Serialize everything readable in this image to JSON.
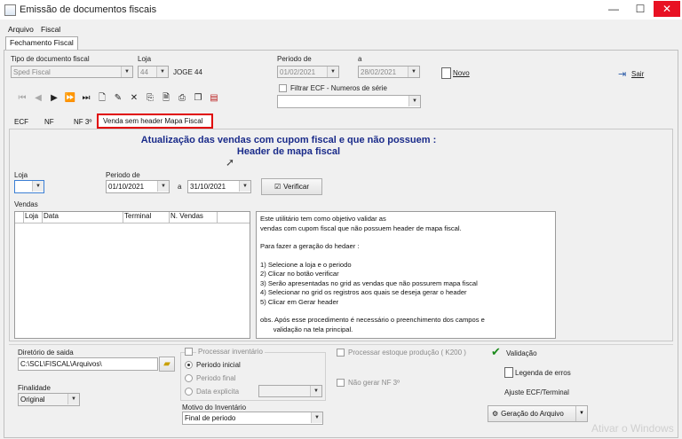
{
  "window": {
    "title": "Emissão de documentos fiscais",
    "min": "—",
    "max": "☐",
    "close": "✕"
  },
  "menu": [
    "Arquivo",
    "Fiscal"
  ],
  "main_tab": "Fechamento Fiscal",
  "top": {
    "tipo_label": "Tipo de documento fiscal",
    "tipo_value": "Sped Fiscal",
    "loja_label": "Loja",
    "loja_value": "44",
    "loja_name": "JOGE 44",
    "periodo_label": "Periodo de",
    "a_label": "a",
    "periodo_de": "01/02/2021",
    "periodo_a": "28/02/2021",
    "filtrar_label": "Filtrar ECF - Numeros de  série",
    "novo_label": "Novo",
    "sair_label": "Sair"
  },
  "toolbar_icons": [
    "first-record-icon",
    "prev-record-icon",
    "next-record-icon",
    "fast-forward-icon",
    "last-record-icon",
    "new-document-icon",
    "edit-document-icon",
    "delete-icon",
    "export-icon",
    "preview-icon",
    "print-icon",
    "copy-icon",
    "report-icon"
  ],
  "subtabs": [
    "ECF",
    "NF",
    "NF 3º",
    "Venda sem header Mapa Fiscal"
  ],
  "content": {
    "heading_line1": "Atualização das vendas com cupom fiscal e que não possuem :",
    "heading_line2": "Header de mapa fiscal",
    "loja_label": "Loja",
    "loja_value": "",
    "periodo_label": "Periodo de",
    "periodo_de": "01/10/2021",
    "a_label": "a",
    "periodo_a": "31/10/2021",
    "verificar_label": "Verificar",
    "vendas_label": "Vendas",
    "grid_columns": [
      "",
      "Loja",
      "Data",
      "Terminal",
      "N. Vendas"
    ],
    "info_lines": [
      "Este utilitário tem como objetivo validar as",
      "vendas com cupom fiscal que não possuem header de mapa fiscal.",
      "",
      "Para fazer a geração do hedaer :",
      "",
      "1) Selecione a loja e o periodo",
      "2) Clicar no botão verificar",
      "3) Serão apresentadas no grid as vendas que não possurem mapa fiscal",
      "4) Selecionar no grid os registros aos quais se deseja gerar o header",
      "5) Clicar em Gerar header",
      "",
      "obs. Após esse procedimento é necessário o preenchimento dos campos e",
      "       validação na tela principal."
    ]
  },
  "bottom": {
    "diretorio_label": "Diretório de saida",
    "diretorio_value": "C:\\SCL\\FISCAL\\Arquivos\\",
    "finalidade_label": "Finalidade",
    "finalidade_value": "Original",
    "processar_inventario": "Processar inventário",
    "periodo_inicial": "Periodo inicial",
    "periodo_final": "Periodo final",
    "data_explicita": "Data explicita",
    "motivo_label": "Motivo do Inventário",
    "motivo_value": "Final de periodo",
    "processar_estoque": "Processar estoque produção ( K200 )",
    "nao_gerar": "Não gerar NF 3º",
    "validacao": "Validação",
    "legenda": "Legenda de erros",
    "ajuste": "Ajuste ECF/Terminal",
    "geracao": "Geração do Arquivo"
  },
  "watermark": "Ativar o Windows",
  "colors": {
    "accent_heading": "#1a2b8a",
    "highlight": "#e00000",
    "check": "#1a8a1a"
  }
}
